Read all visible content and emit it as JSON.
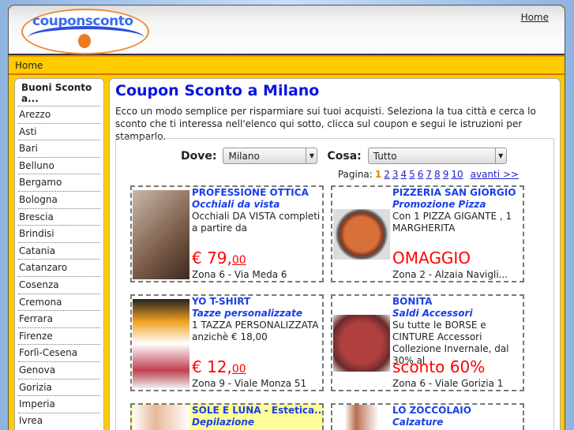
{
  "header": {
    "logo_text": "couponsconto",
    "home_link": "Home"
  },
  "nav": {
    "home": "Home"
  },
  "sidebar": {
    "title": "Buoni Sconto a...",
    "items": [
      "Arezzo",
      "Asti",
      "Bari",
      "Belluno",
      "Bergamo",
      "Bologna",
      "Brescia",
      "Brindisi",
      "Catania",
      "Catanzaro",
      "Cosenza",
      "Cremona",
      "Ferrara",
      "Firenze",
      "Forlì-Cesena",
      "Genova",
      "Gorizia",
      "Imperia",
      "Ivrea"
    ]
  },
  "main": {
    "title": "Coupon Sconto a Milano",
    "intro": "Ecco un modo semplice per risparmiare sui tuoi acquisti. Seleziona la tua città e cerca lo sconto che ti interessa nell'elenco qui sotto, clicca sul coupon e segui le istruzioni per stamparlo.",
    "dove_label": "Dove:",
    "dove_value": "Milano",
    "cosa_label": "Cosa:",
    "cosa_value": "Tutto",
    "pagination": {
      "label": "Pagina:",
      "current": "1",
      "pages": [
        "2",
        "3",
        "4",
        "5",
        "6",
        "7",
        "8",
        "9",
        "10"
      ],
      "next": "avanti >>"
    }
  },
  "coupons": [
    {
      "name": "PROFESSIONE OTTICA",
      "subtitle": "Occhiali da vista",
      "desc": "Occhiali DA VISTA completi a partire da",
      "price": "€ 79,",
      "cents": "00",
      "zone": "Zona 6 - Via Meda 6"
    },
    {
      "name": "PIZZERIA SAN GIORGIO",
      "subtitle": "Promozione Pizza",
      "desc": "Con 1 PIZZA GIGANTE , 1 MARGHERITA",
      "price": "OMAGGIO",
      "cents": "",
      "zone": "Zona 2 - Alzaia Navigli..."
    },
    {
      "name": "YO T-SHIRT",
      "subtitle": "Tazze personalizzate",
      "desc": "1 TAZZA PERSONALIZZATA anzichè € 18,00",
      "price": "€ 12,",
      "cents": "00",
      "zone": "Zona 9 - Viale Monza 51"
    },
    {
      "name": "BONITA",
      "subtitle": "Saldi Accessori",
      "desc": "Su tutte le BORSE e CINTURE Accessori Collezione Invernale, dal 30% al",
      "price": "sconto 60%",
      "cents": "",
      "zone": "Zona 6 - Viale Gorizia 1"
    },
    {
      "name": "SOLE E LUNA - Estetica...",
      "subtitle": "Depilazione",
      "desc": "",
      "price": "",
      "cents": "",
      "zone": ""
    },
    {
      "name": "LO ZOCCOLAIO",
      "subtitle": "Calzature",
      "desc": "",
      "price": "",
      "cents": "",
      "zone": ""
    }
  ]
}
